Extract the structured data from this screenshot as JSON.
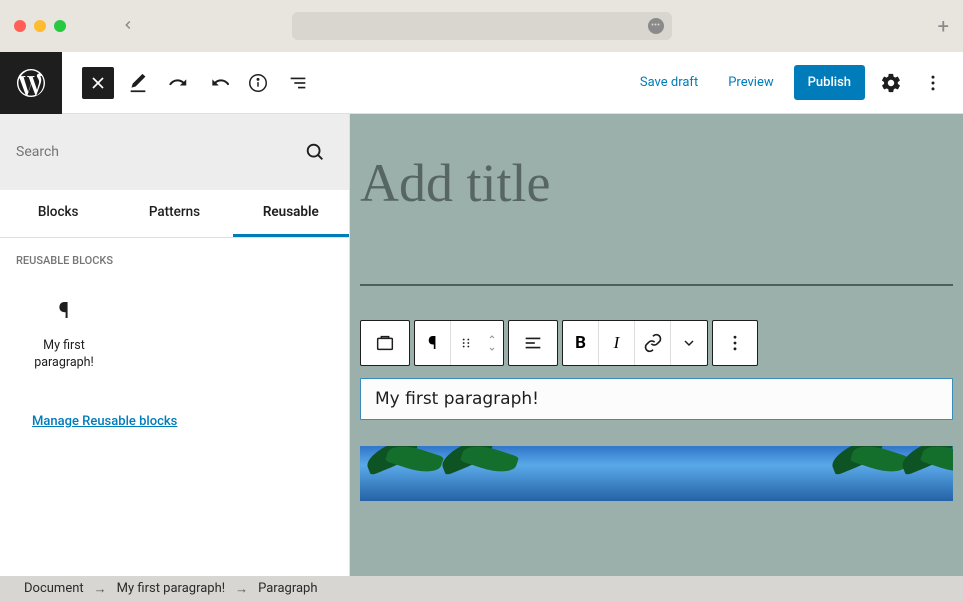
{
  "browser": {},
  "toolbar": {
    "save_draft": "Save draft",
    "preview": "Preview",
    "publish": "Publish"
  },
  "inserter": {
    "search_placeholder": "Search",
    "tabs": {
      "blocks": "Blocks",
      "patterns": "Patterns",
      "reusable": "Reusable"
    },
    "heading": "REUSABLE BLOCKS",
    "items": [
      {
        "icon": "¶",
        "label": "My first paragraph!"
      }
    ],
    "manage_link": "Manage Reusable blocks"
  },
  "editor": {
    "title_placeholder": "Add title",
    "paragraph_text": "My first paragraph!"
  },
  "breadcrumb": {
    "items": [
      "Document",
      "My first paragraph!",
      "Paragraph"
    ]
  },
  "colors": {
    "primary": "#007cba",
    "dark": "#1e1e1e",
    "canvas": "#9bb0aa"
  }
}
